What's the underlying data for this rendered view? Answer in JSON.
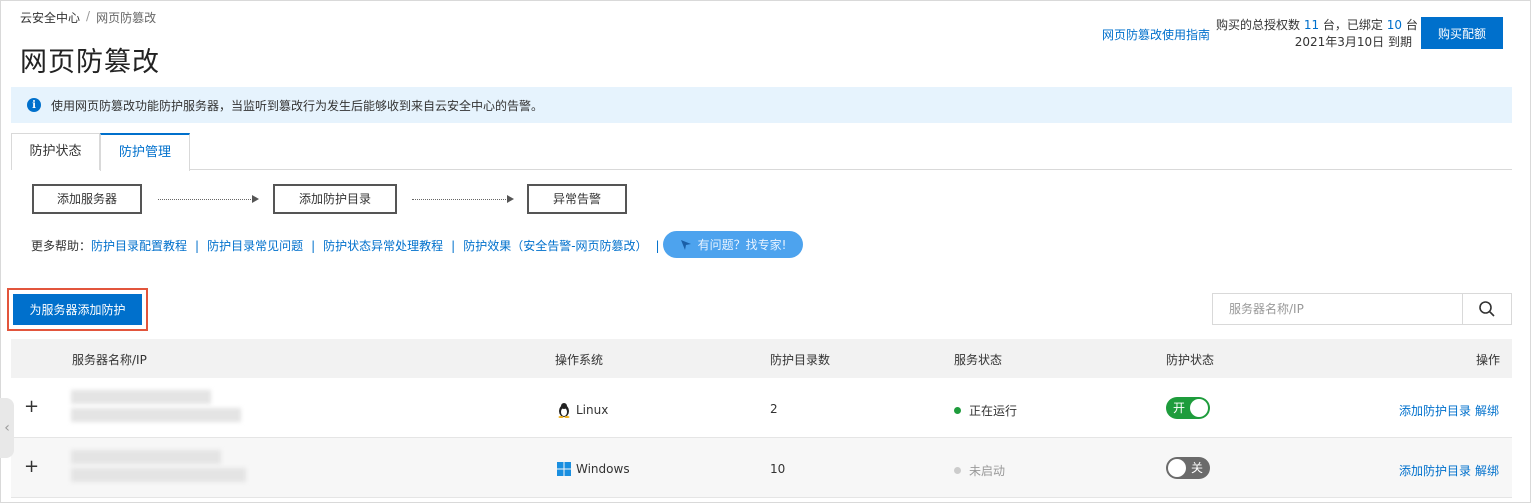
{
  "breadcrumb": {
    "root": "云安全中心",
    "separator": "/",
    "current": "网页防篡改"
  },
  "page_title": "网页防篡改",
  "header": {
    "guide_link": "网页防篡改使用指南",
    "quota_line1_prefix": "购买的总授权数 ",
    "quota_total": "11",
    "quota_mid": " 台，已绑定 ",
    "quota_bound": "10",
    "quota_suffix": " 台",
    "quota_line2": "2021年3月10日 到期",
    "buy_button": "购买配额"
  },
  "notice": {
    "icon": "info-icon",
    "text": "使用网页防篡改功能防护服务器，当监听到篡改行为发生后能够收到来自云安全中心的告警。"
  },
  "tabs": [
    {
      "label": "防护状态",
      "active": false
    },
    {
      "label": "防护管理",
      "active": true
    }
  ],
  "steps": [
    "添加服务器",
    "添加防护目录",
    "异常告警"
  ],
  "help": {
    "prefix": "更多帮助：",
    "links": [
      "防护目录配置教程",
      "防护目录常见问题",
      "防护状态异常处理教程",
      "防护效果（安全告警-网页防篡改）"
    ],
    "separator": "|",
    "expert_button": "有问题？找专家!"
  },
  "add_protection_button": "为服务器添加防护",
  "search": {
    "placeholder": "服务器名称/IP"
  },
  "table": {
    "columns": [
      "服务器名称/IP",
      "操作系统",
      "防护目录数",
      "服务状态",
      "防护状态",
      "操作"
    ],
    "rows": [
      {
        "expand": "+",
        "os": "Linux",
        "os_icon": "linux-icon",
        "dir_count": "2",
        "service_status": "正在运行",
        "status_color": "#1e9c3c",
        "protect_toggle": "开",
        "protect_on": true,
        "action_add": "添加防护目录",
        "action_unbind": "解绑"
      },
      {
        "expand": "+",
        "os": "Windows",
        "os_icon": "windows-icon",
        "dir_count": "10",
        "service_status": "未启动",
        "status_color": "#cccccc",
        "protect_toggle": "关",
        "protect_on": false,
        "action_add": "添加防护目录",
        "action_unbind": "解绑"
      }
    ]
  },
  "colors": {
    "accent": "#0070cc",
    "notice_bg": "#e6f3fd",
    "highlight_border": "#e2553c",
    "toggle_on": "#1e9c3c",
    "toggle_off": "#6b6b6b"
  }
}
